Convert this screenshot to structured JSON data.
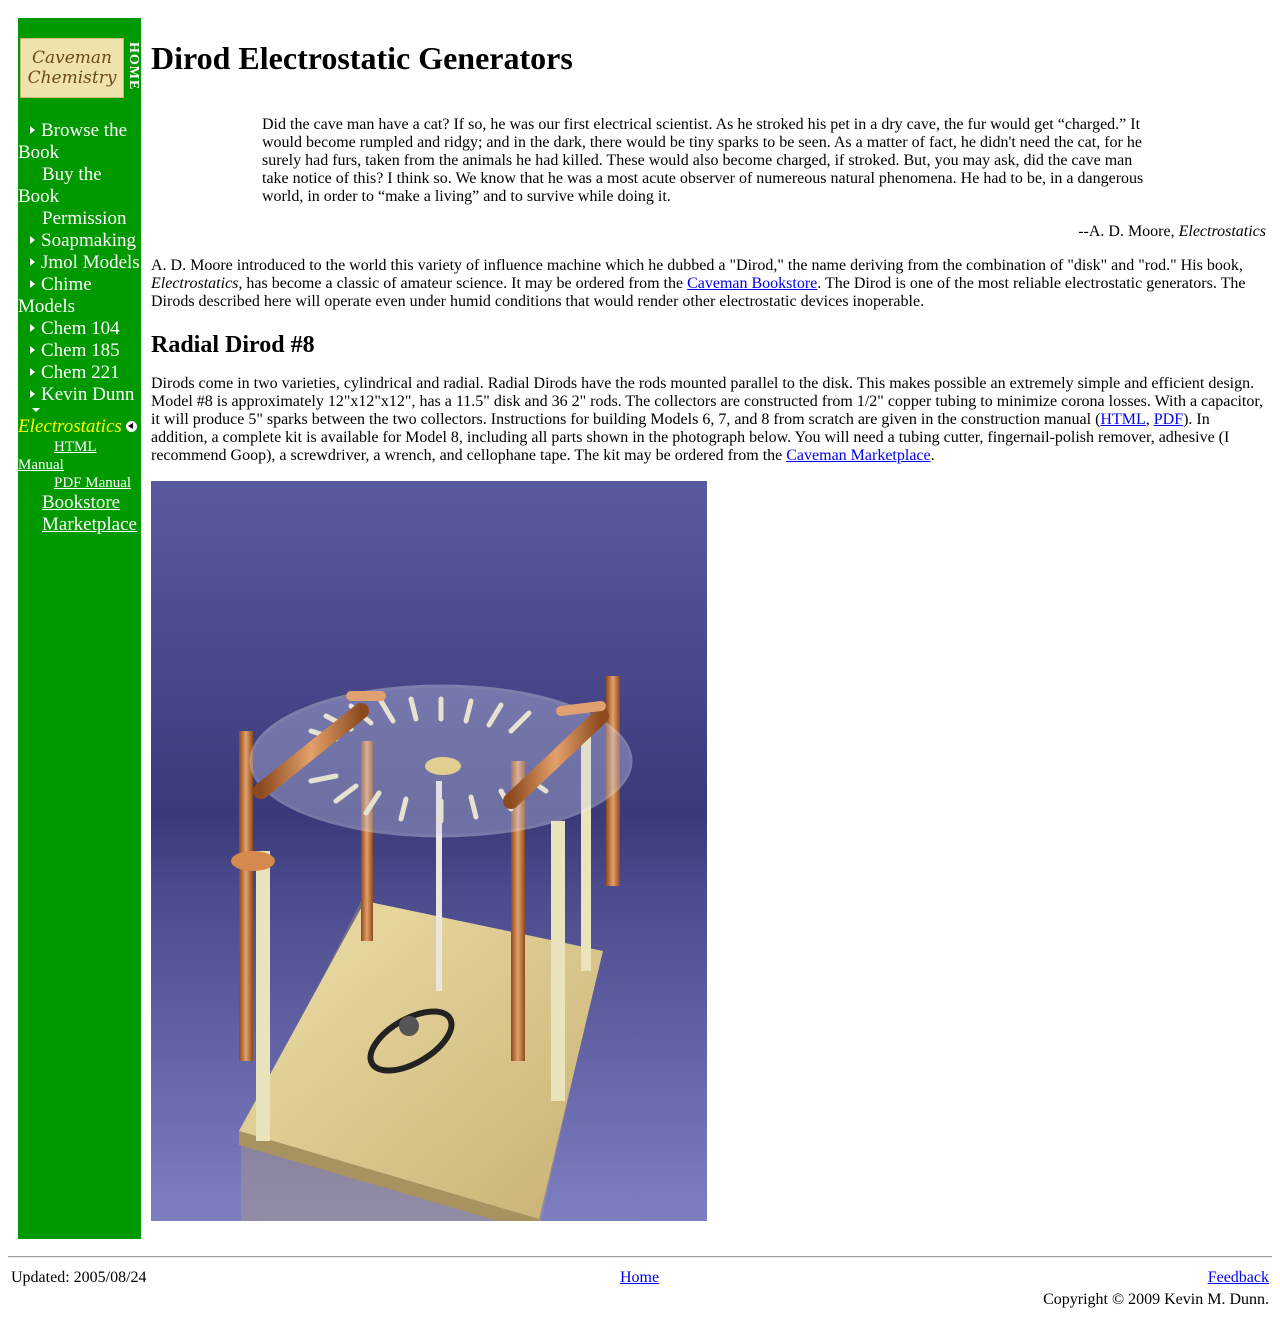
{
  "sidebar": {
    "logo_line1": "Caveman",
    "logo_line2": "Chemistry",
    "home_label": "HOME",
    "nav": [
      {
        "label": "Browse the Book"
      },
      {
        "label": "Buy the Book"
      },
      {
        "label": "Permission"
      },
      {
        "label": "Soapmaking"
      },
      {
        "label": "Jmol Models"
      },
      {
        "label": "Chime Models"
      },
      {
        "label": "Chem 104"
      },
      {
        "label": "Chem 185"
      },
      {
        "label": "Chem 221"
      },
      {
        "label": "Kevin Dunn"
      }
    ],
    "current": "Electrostatics",
    "sub_items": [
      "HTML Manual",
      "PDF Manual"
    ],
    "extra_items": [
      "Bookstore",
      "Marketplace"
    ]
  },
  "main": {
    "title": "Dirod Electrostatic Generators",
    "quote": "Did the cave man have a cat? If so, he was our first electrical scientist. As he stroked his pet in a dry cave, the fur would get “charged.” It would become rumpled and ridgy; and in the dark, there would be tiny sparks to be seen. As a matter of fact, he didn't need the cat, for he surely had furs, taken from the animals he had killed. These would also become charged, if stroked. But, you may ask, did the cave man take notice of this? I think so. We know that he was a most acute observer of numereous natural phenomena. He had to be, in a dangerous world, in order to “make a living” and to survive while doing it.",
    "attribution_prefix": "--A. D. Moore, ",
    "attribution_book": "Electrostatics",
    "intro_part1": "A. D. Moore introduced to the world this variety of influence machine which he dubbed a \"Dirod,\" the name deriving from the combination of \"disk\" and \"rod.\" His book, ",
    "intro_book": "Electrostatics,",
    "intro_part2": " has become a classic of amateur science. It may be ordered from the ",
    "intro_link": "Caveman Bookstore",
    "intro_part3": ". The Dirod is one of the most reliable electrostatic generators. The Dirods described here will operate even under humid conditions that would render other electrostatic devices inoperable.",
    "section_title": "Radial Dirod #8",
    "section_part1": "Dirods come in two varieties, cylindrical and radial. Radial Dirods have the rods mounted parallel to the disk. This makes possible an extremely simple and efficient design. Model #8 is approximately 12\"x12\"x12\", has a 11.5\" disk and 36 2\" rods. The collectors are constructed from 1/2\" copper tubing to minimize corona losses. With a capacitor, it will produce 5\" sparks between the two collectors. Instructions for building Models 6, 7, and 8 from scratch are given in the construction manual (",
    "section_link_html": "HTML",
    "section_sep": ", ",
    "section_link_pdf": "PDF",
    "section_part2": "). In addition, a complete kit is available for Model 8, including all parts shown in the photograph below. You will need a tubing cutter, fingernail-polish remover, adhesive (I recommend Goop), a screwdriver, a wrench, and cellophane tape. The kit may be ordered from the ",
    "section_link_market": "Caveman Marketplace",
    "section_end": "."
  },
  "footer": {
    "updated": "Updated: 2005/08/24",
    "home": "Home",
    "feedback": "Feedback",
    "copyright": "Copyright © 2009 Kevin M. Dunn."
  },
  "colors": {
    "sidebar_bg": "#009900",
    "current_nav": "#ffff00",
    "link": "#0000ee"
  }
}
